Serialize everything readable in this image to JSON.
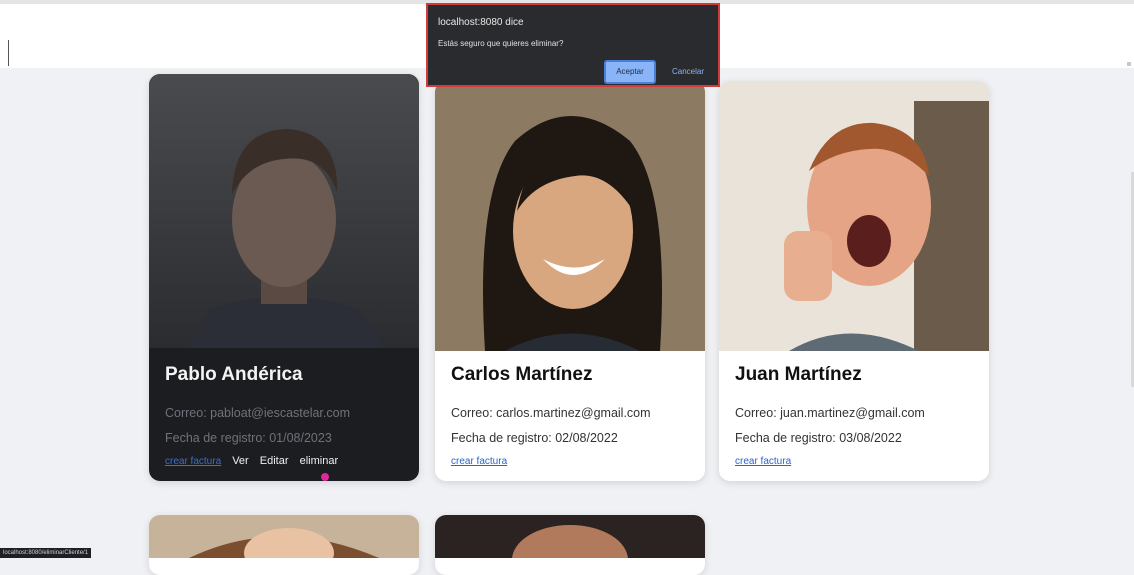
{
  "dialog": {
    "origin": "localhost:8080 dice",
    "message": "Estás seguro que quieres eliminar?",
    "ok_label": "Aceptar",
    "cancel_label": "Cancelar"
  },
  "clients": [
    {
      "name": "Pablo Andérica",
      "email": "Correo: pabloat@iescastelar.com",
      "date": "Fecha de registro: 01/08/2023",
      "invoice_link": "crear factura",
      "view_label": "Ver",
      "edit_label": "Editar",
      "delete_label": "eliminar"
    },
    {
      "name": "Carlos Martínez",
      "email": "Correo: carlos.martinez@gmail.com",
      "date": "Fecha de registro: 02/08/2022",
      "invoice_link": "crear factura"
    },
    {
      "name": "Juan Martínez",
      "email": "Correo: juan.martinez@gmail.com",
      "date": "Fecha de registro: 03/08/2022",
      "invoice_link": "crear factura"
    }
  ],
  "status_url": "localhost:8080/eliminarCliente/1",
  "colors": {
    "accent": "#8ab4f8",
    "dialog_border": "#cf3c3c",
    "link": "#2a64c9",
    "hover_card": "#1c1d21"
  }
}
